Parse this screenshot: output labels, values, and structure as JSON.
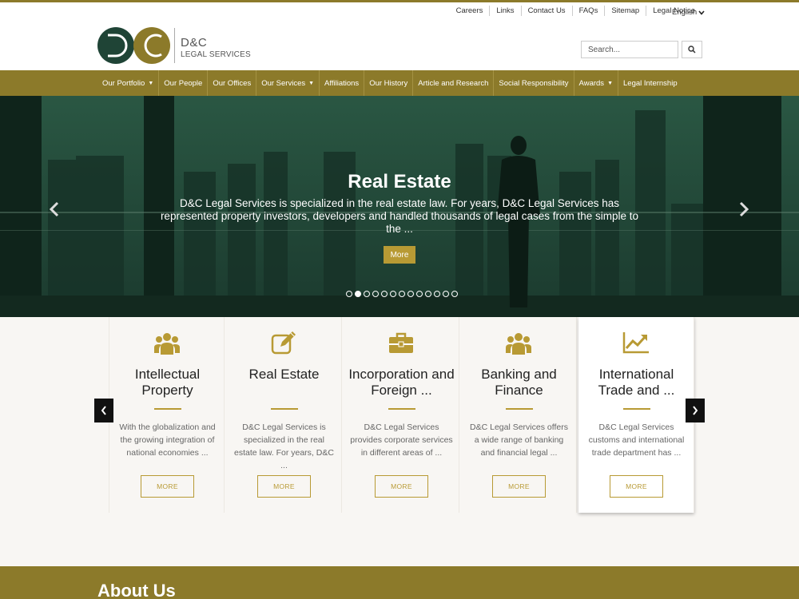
{
  "utility": {
    "links": [
      "Careers",
      "Links",
      "Contact Us",
      "FAQs",
      "Sitemap",
      "Legal Notice"
    ],
    "language": "English"
  },
  "logo": {
    "name": "D&C",
    "subtitle": "LEGAL SERVICES"
  },
  "search": {
    "placeholder": "Search..."
  },
  "nav": [
    {
      "label": "Our Portfolio",
      "dropdown": true
    },
    {
      "label": "Our People",
      "dropdown": false
    },
    {
      "label": "Our Offices",
      "dropdown": false
    },
    {
      "label": "Our Services",
      "dropdown": true
    },
    {
      "label": "Affiliations",
      "dropdown": false
    },
    {
      "label": "Our History",
      "dropdown": false
    },
    {
      "label": "Article and Research",
      "dropdown": false
    },
    {
      "label": "Social Responsibility",
      "dropdown": false
    },
    {
      "label": "Awards",
      "dropdown": true
    },
    {
      "label": "Legal Internship",
      "dropdown": false
    }
  ],
  "hero": {
    "title": "Real Estate",
    "text": "D&C Legal Services is specialized in the real estate law. For years, D&C Legal Services has represented property investors, developers and handled thousands of legal cases from the simple to the ...",
    "button": "More",
    "slide_count": 13,
    "active_slide": 2
  },
  "services": [
    {
      "icon": "people-group-icon",
      "title": "Intellectual Property",
      "text": "With the globalization and the growing integration of national economies ...",
      "button": "MORE"
    },
    {
      "icon": "edit-icon",
      "title": "Real Estate",
      "text": "D&C Legal Services is specialized in the real estate law. For years, D&C ...",
      "button": "MORE"
    },
    {
      "icon": "briefcase-icon",
      "title": "Incorporation and Foreign ...",
      "text": "D&C Legal Services provides corporate services in different areas of ...",
      "button": "MORE"
    },
    {
      "icon": "people-group-icon",
      "title": "Banking and Finance",
      "text": "D&C Legal Services offers a wide range of banking and financial legal ...",
      "button": "MORE"
    },
    {
      "icon": "trend-chart-icon",
      "title": "International Trade and ...",
      "text": "D&C Legal Services customs and international trade department has ...",
      "button": "MORE"
    }
  ],
  "about": {
    "title": "About Us"
  },
  "colors": {
    "brand_gold": "#8c7a2a",
    "accent_gold": "#b89a34",
    "hero_green": "#1f4436"
  }
}
